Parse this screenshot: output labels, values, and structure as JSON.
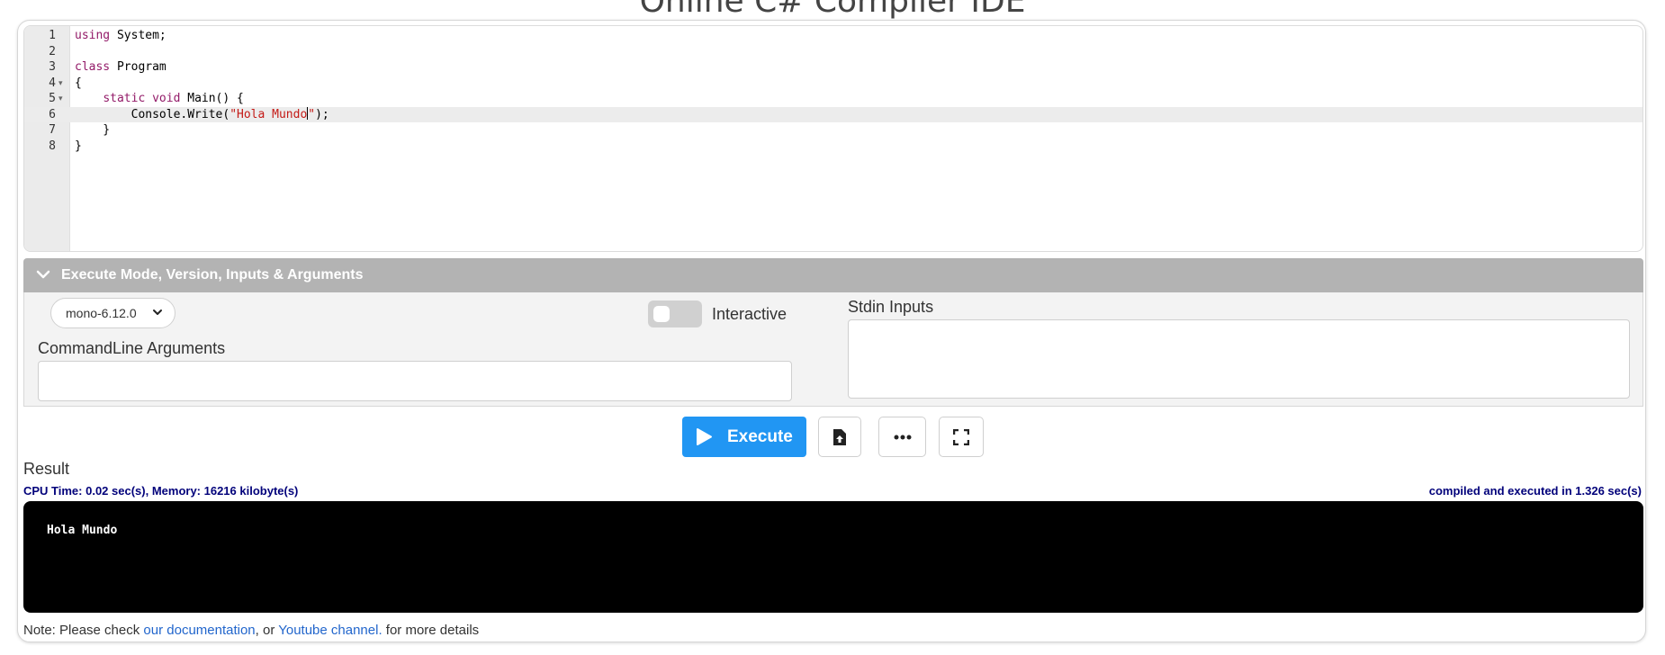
{
  "page": {
    "title": "Online C# Compiler IDE"
  },
  "editor": {
    "line_numbers": [
      "1",
      "2",
      "3",
      "4",
      "5",
      "6",
      "7",
      "8"
    ],
    "active_line": "6"
  },
  "options": {
    "header_label": "Execute Mode, Version, Inputs & Arguments",
    "version_value": "mono-6.12.0",
    "interactive_label": "Interactive",
    "interactive_on": false,
    "cmdline_label": "CommandLine Arguments",
    "cmdline_value": "",
    "stdin_label": "Stdin Inputs",
    "stdin_value": ""
  },
  "toolbar": {
    "execute_label": "Execute",
    "icons": [
      "upload-file-icon",
      "more-options-icon",
      "fullscreen-icon"
    ],
    "accent_color": "#2196f3"
  },
  "result": {
    "label": "Result",
    "cpu_info": "CPU Time: 0.02 sec(s), Memory: 16216 kilobyte(s)",
    "compile_info": "compiled and executed in 1.326 sec(s)",
    "output_text": "Hola Mundo"
  },
  "note": {
    "prefix": "Note: Please check ",
    "doc_link": "our documentation",
    "middle": ", or ",
    "youtube_link": "Youtube channel.",
    "suffix": " for more details"
  }
}
